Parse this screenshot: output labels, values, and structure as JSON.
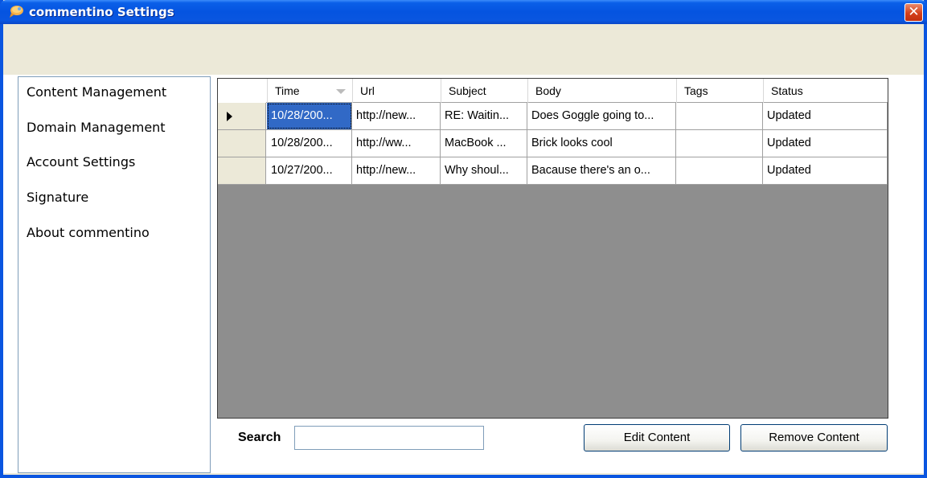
{
  "window": {
    "title": "commentino Settings",
    "close_label": "✕",
    "accent": "#0a55e0"
  },
  "nav": {
    "items": [
      {
        "label": "Content Management"
      },
      {
        "label": "Domain Management"
      },
      {
        "label": "Account Settings"
      },
      {
        "label": "Signature"
      },
      {
        "label": "About commentino"
      }
    ]
  },
  "grid": {
    "columns": [
      "Time",
      "Url",
      "Subject",
      "Body",
      "Tags",
      "Status"
    ],
    "rows": [
      [
        "10/28/200...",
        "http://new...",
        "RE: Waitin...",
        "Does Goggle going to...",
        "",
        "Updated"
      ],
      [
        "10/28/200...",
        "http://ww...",
        "MacBook ...",
        "Brick looks cool",
        "",
        "Updated"
      ],
      [
        "10/27/200...",
        "http://new...",
        "Why shoul...",
        "Bacause there's an o...",
        "",
        "Updated"
      ]
    ],
    "selected_row": 0,
    "selected_column": 0,
    "sort_column": "Time"
  },
  "search": {
    "label": "Search",
    "value": ""
  },
  "buttons": {
    "edit": "Edit Content",
    "remove": "Remove Content"
  }
}
